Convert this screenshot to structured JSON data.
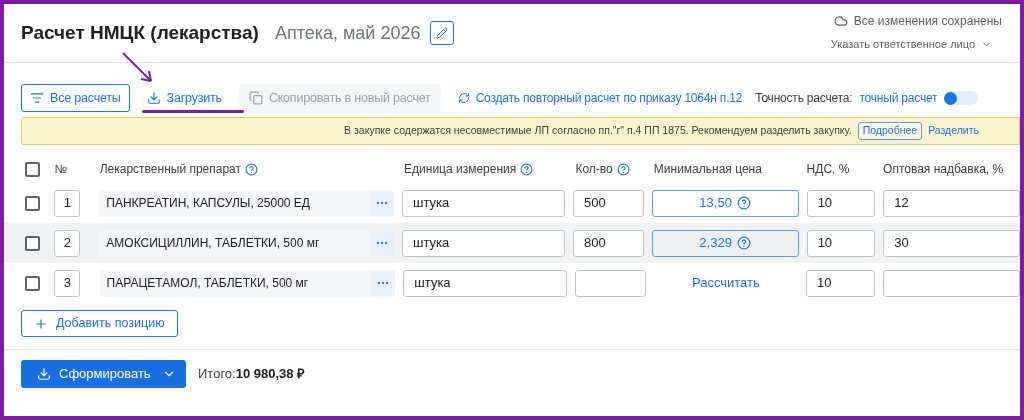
{
  "header": {
    "title": "Расчет НМЦК (лекарства)",
    "subtitle": "Аптека, май 2026",
    "save_status": "Все изменения сохранены",
    "responsible": "Указать ответственное лицо"
  },
  "toolbar": {
    "all_calcs": "Все расчеты",
    "upload": "Загрузить",
    "copy": {
      "label": "Скопировать в новый расчет",
      "disabled": true
    },
    "repeat": "Создать повторный расчет по приказу 1064н п.12",
    "accuracy_label": "Точность расчета:",
    "accuracy_value": "точный расчет",
    "toggle": {
      "on": false
    }
  },
  "banner": {
    "text": "В закупке содержатся несовместимые ЛП согласно пп.\"г\" п.4 ПП 1875. Рекомендуем разделить закупку.",
    "details": "Подробнее",
    "split": "Разделить"
  },
  "table": {
    "select_all": {
      "checked": false
    },
    "columns": [
      {
        "label": "№",
        "help": false
      },
      {
        "label": "Лекарственный препарат",
        "help": true
      },
      {
        "label": "Единица измерения",
        "help": true
      },
      {
        "label": "Кол-во",
        "help": true
      },
      {
        "label": "Минимальная цена",
        "help": false
      },
      {
        "label": "НДС, %",
        "help": false
      },
      {
        "label": "Оптовая надбавка, %",
        "help": false
      }
    ],
    "rows": [
      {
        "checked": false,
        "highlighted": false,
        "number": "1",
        "drug": "ПАНКРЕАТИН, КАПСУЛЫ, 25000 ЕД",
        "unit": "штука",
        "qty": "500",
        "price": {
          "kind": "value",
          "text": "13,50"
        },
        "vat": "10",
        "markup": "12"
      },
      {
        "checked": false,
        "highlighted": true,
        "number": "2",
        "drug": "АМОКСИЦИЛЛИН, ТАБЛЕТКИ, 500 мг",
        "unit": "штука",
        "qty": "800",
        "price": {
          "kind": "value",
          "text": "2,329"
        },
        "vat": "10",
        "markup": "30"
      },
      {
        "checked": false,
        "highlighted": false,
        "number": "3",
        "drug": "ПАРАЦЕТАМОЛ, ТАБЛЕТКИ, 500 мг",
        "unit": "штука",
        "qty": "",
        "price": {
          "kind": "action",
          "text": "Рассчитать"
        },
        "vat": "10",
        "markup": ""
      }
    ],
    "add_row": "Добавить позицию"
  },
  "footer": {
    "generate": "Сформировать",
    "total_label": "Итого:",
    "total_value": "10 980,38 ₽"
  }
}
